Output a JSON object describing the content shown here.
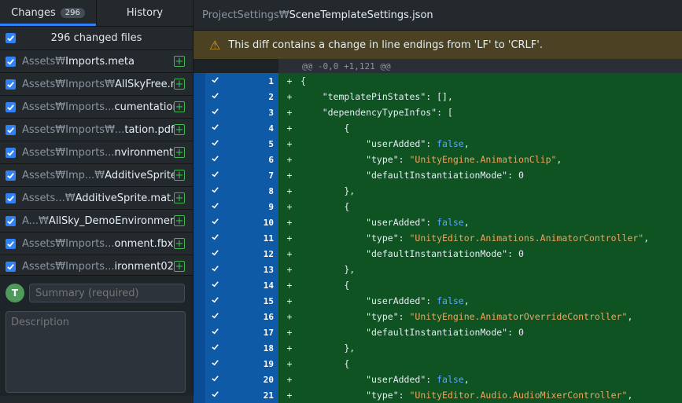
{
  "tabs": {
    "changes_label": "Changes",
    "changes_count": "296",
    "history_label": "History"
  },
  "changed_files_label": "296 changed files",
  "files": [
    {
      "dir": "Assets₩",
      "base": "Imports.meta"
    },
    {
      "dir": "Assets₩Imports₩",
      "base": "AllSkyFree.meta"
    },
    {
      "dir": "Assets₩Imports...",
      "base": "cumentation.pdf"
    },
    {
      "dir": "Assets₩Imports₩...",
      "base": "tation.pdf.meta"
    },
    {
      "dir": "Assets₩Imports...",
      "base": "nvironment.meta"
    },
    {
      "dir": "Assets₩Imp...₩",
      "base": "AdditiveSprite.mat"
    },
    {
      "dir": "Assets...₩",
      "base": "AdditiveSprite.mat.meta"
    },
    {
      "dir": "A...₩",
      "base": "AllSky_DemoEnvironment.fbx"
    },
    {
      "dir": "Assets₩Imports...",
      "base": "onment.fbx.meta"
    },
    {
      "dir": "Assets₩Imports...",
      "base": "ironment02.fbx"
    }
  ],
  "commit": {
    "avatar": "T",
    "summary_placeholder": "Summary (required)",
    "description_placeholder": "Description"
  },
  "diff": {
    "path_dir": "ProjectSettings₩",
    "path_file": "SceneTemplateSettings.json",
    "warning": "This diff contains a change in line endings from 'LF' to 'CRLF'.",
    "hunk": "@@ -0,0 +1,121 @@",
    "lines": [
      {
        "n": "1",
        "code": [
          {
            "t": "{",
            "c": "k"
          }
        ]
      },
      {
        "n": "2",
        "code": [
          {
            "t": "    \"templatePinStates\": [],",
            "c": "k"
          }
        ]
      },
      {
        "n": "3",
        "code": [
          {
            "t": "    \"dependencyTypeInfos\": [",
            "c": "k"
          }
        ]
      },
      {
        "n": "4",
        "code": [
          {
            "t": "        {",
            "c": "k"
          }
        ]
      },
      {
        "n": "5",
        "code": [
          {
            "t": "            \"userAdded\": ",
            "c": "k"
          },
          {
            "t": "false",
            "c": "b"
          },
          {
            "t": ",",
            "c": "k"
          }
        ]
      },
      {
        "n": "6",
        "code": [
          {
            "t": "            \"type\": ",
            "c": "k"
          },
          {
            "t": "\"UnityEngine.AnimationClip\"",
            "c": "s"
          },
          {
            "t": ",",
            "c": "k"
          }
        ]
      },
      {
        "n": "7",
        "code": [
          {
            "t": "            \"defaultInstantiationMode\": 0",
            "c": "k"
          }
        ]
      },
      {
        "n": "8",
        "code": [
          {
            "t": "        },",
            "c": "k"
          }
        ]
      },
      {
        "n": "9",
        "code": [
          {
            "t": "        {",
            "c": "k"
          }
        ]
      },
      {
        "n": "10",
        "code": [
          {
            "t": "            \"userAdded\": ",
            "c": "k"
          },
          {
            "t": "false",
            "c": "b"
          },
          {
            "t": ",",
            "c": "k"
          }
        ]
      },
      {
        "n": "11",
        "code": [
          {
            "t": "            \"type\": ",
            "c": "k"
          },
          {
            "t": "\"UnityEditor.Animations.AnimatorController\"",
            "c": "s"
          },
          {
            "t": ",",
            "c": "k"
          }
        ]
      },
      {
        "n": "12",
        "code": [
          {
            "t": "            \"defaultInstantiationMode\": 0",
            "c": "k"
          }
        ]
      },
      {
        "n": "13",
        "code": [
          {
            "t": "        },",
            "c": "k"
          }
        ]
      },
      {
        "n": "14",
        "code": [
          {
            "t": "        {",
            "c": "k"
          }
        ]
      },
      {
        "n": "15",
        "code": [
          {
            "t": "            \"userAdded\": ",
            "c": "k"
          },
          {
            "t": "false",
            "c": "b"
          },
          {
            "t": ",",
            "c": "k"
          }
        ]
      },
      {
        "n": "16",
        "code": [
          {
            "t": "            \"type\": ",
            "c": "k"
          },
          {
            "t": "\"UnityEngine.AnimatorOverrideController\"",
            "c": "s"
          },
          {
            "t": ",",
            "c": "k"
          }
        ]
      },
      {
        "n": "17",
        "code": [
          {
            "t": "            \"defaultInstantiationMode\": 0",
            "c": "k"
          }
        ]
      },
      {
        "n": "18",
        "code": [
          {
            "t": "        },",
            "c": "k"
          }
        ]
      },
      {
        "n": "19",
        "code": [
          {
            "t": "        {",
            "c": "k"
          }
        ]
      },
      {
        "n": "20",
        "code": [
          {
            "t": "            \"userAdded\": ",
            "c": "k"
          },
          {
            "t": "false",
            "c": "b"
          },
          {
            "t": ",",
            "c": "k"
          }
        ]
      },
      {
        "n": "21",
        "code": [
          {
            "t": "            \"type\": ",
            "c": "k"
          },
          {
            "t": "\"UnityEditor.Audio.AudioMixerController\"",
            "c": "s"
          },
          {
            "t": ",",
            "c": "k"
          }
        ]
      }
    ]
  },
  "colors": {
    "accent": "#2f81f7",
    "added_bg": "#0f5323",
    "gutter_selected": "#0e5aa6",
    "warning_bg": "#4b4223"
  }
}
